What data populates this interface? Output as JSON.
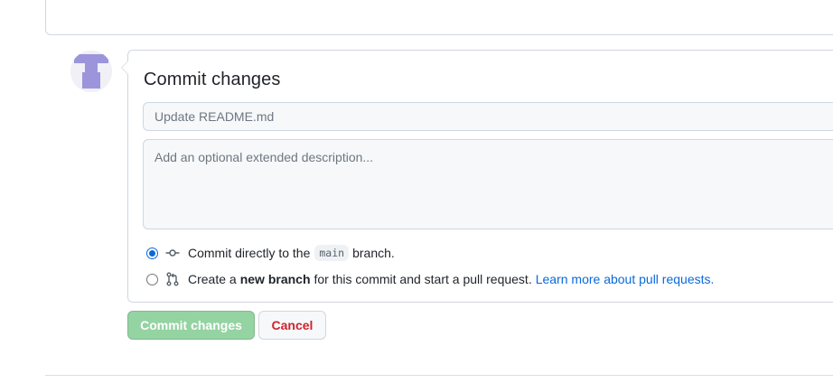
{
  "commit_form": {
    "title": "Commit changes",
    "summary_placeholder": "Update README.md",
    "description_placeholder": "Add an optional extended description...",
    "options": {
      "direct": {
        "prefix": "Commit directly to the",
        "branch": "main",
        "suffix": "branch.",
        "selected": true
      },
      "new_branch": {
        "prefix": "Create a",
        "bold": "new branch",
        "suffix": "for this commit and start a pull request.",
        "link": "Learn more about pull requests.",
        "selected": false
      }
    }
  },
  "buttons": {
    "commit_label": "Commit changes",
    "cancel_label": "Cancel"
  },
  "colors": {
    "accent": "#0969da",
    "commit_button_bg": "#94d3a2",
    "cancel_text": "#cf222e",
    "avatar_glyph": "#9c95dc"
  },
  "icons": {
    "direct": "git-commit-icon",
    "new_branch": "git-pull-request-icon"
  }
}
